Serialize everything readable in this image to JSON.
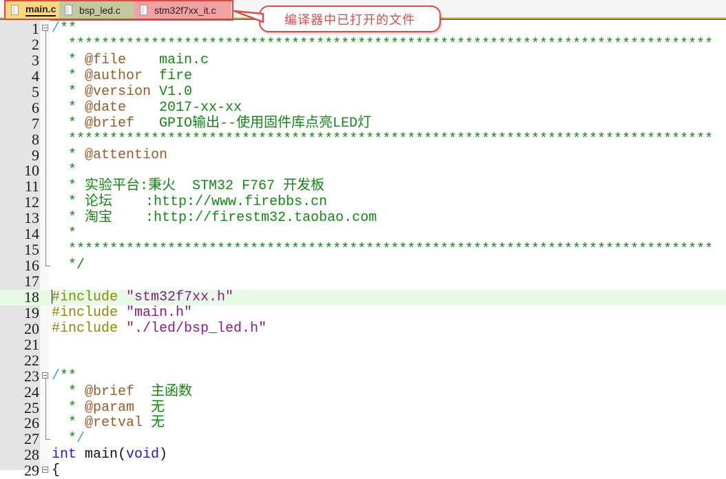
{
  "tabs": [
    {
      "label": "main.c",
      "active": true,
      "color": "#fdd77b"
    },
    {
      "label": "bsp_led.c",
      "active": false,
      "color": "#c2c99c"
    },
    {
      "label": "stm32f7xx_it.c",
      "active": false,
      "color": "#f2a0a0"
    }
  ],
  "annotation": {
    "text": "编译器中已打开的文件",
    "color": "#e24848"
  },
  "editor": {
    "current_line": 18,
    "lines": [
      {
        "n": "1",
        "parts": [
          [
            "slash",
            "/"
          ],
          [
            "cmt",
            "**"
          ]
        ]
      },
      {
        "n": "2",
        "parts": [
          [
            "cmt",
            "  ******************************************************************************"
          ]
        ]
      },
      {
        "n": "3",
        "parts": [
          [
            "cmt",
            "  * "
          ],
          [
            "tag",
            "@file"
          ],
          [
            "cmt",
            "    main.c"
          ]
        ]
      },
      {
        "n": "4",
        "parts": [
          [
            "cmt",
            "  * "
          ],
          [
            "tag",
            "@author"
          ],
          [
            "cmt",
            "  fire"
          ]
        ]
      },
      {
        "n": "5",
        "parts": [
          [
            "cmt",
            "  * "
          ],
          [
            "tag",
            "@version"
          ],
          [
            "cmt",
            " V1.0"
          ]
        ]
      },
      {
        "n": "6",
        "parts": [
          [
            "cmt",
            "  * "
          ],
          [
            "tag",
            "@date"
          ],
          [
            "cmt",
            "    2017-xx-xx"
          ]
        ]
      },
      {
        "n": "7",
        "parts": [
          [
            "cmt",
            "  * "
          ],
          [
            "tag",
            "@brief"
          ],
          [
            "cmt",
            "   GPIO输出--使用固件库点亮LED灯"
          ]
        ]
      },
      {
        "n": "8",
        "parts": [
          [
            "cmt",
            "  ******************************************************************************"
          ]
        ]
      },
      {
        "n": "9",
        "parts": [
          [
            "cmt",
            "  * "
          ],
          [
            "tag",
            "@attention"
          ]
        ]
      },
      {
        "n": "10",
        "parts": [
          [
            "cmt",
            "  *"
          ]
        ]
      },
      {
        "n": "11",
        "parts": [
          [
            "cmt",
            "  * 实验平台:秉火  STM32 F767 开发板"
          ]
        ]
      },
      {
        "n": "12",
        "parts": [
          [
            "cmt",
            "  * 论坛    :http://www.firebbs.cn"
          ]
        ]
      },
      {
        "n": "13",
        "parts": [
          [
            "cmt",
            "  * 淘宝    :http://firestm32.taobao.com"
          ]
        ]
      },
      {
        "n": "14",
        "parts": [
          [
            "cmt",
            "  *"
          ]
        ]
      },
      {
        "n": "15",
        "parts": [
          [
            "cmt",
            "  ******************************************************************************"
          ]
        ]
      },
      {
        "n": "16",
        "parts": [
          [
            "cmt",
            "  */"
          ]
        ]
      },
      {
        "n": "17",
        "parts": []
      },
      {
        "n": "18",
        "parts": [
          [
            "pp",
            "#include "
          ],
          [
            "str",
            "\"stm32f7xx.h\""
          ]
        ]
      },
      {
        "n": "19",
        "parts": [
          [
            "pp",
            "#include "
          ],
          [
            "str",
            "\"main.h\""
          ]
        ]
      },
      {
        "n": "20",
        "parts": [
          [
            "pp",
            "#include "
          ],
          [
            "str",
            "\"./led/bsp_led.h\""
          ]
        ]
      },
      {
        "n": "21",
        "parts": []
      },
      {
        "n": "22",
        "parts": []
      },
      {
        "n": "23",
        "parts": [
          [
            "slash",
            "/"
          ],
          [
            "cmt",
            "**"
          ]
        ]
      },
      {
        "n": "24",
        "parts": [
          [
            "cmt",
            "  * "
          ],
          [
            "tag",
            "@brief"
          ],
          [
            "cmt",
            "  主函数"
          ]
        ]
      },
      {
        "n": "25",
        "parts": [
          [
            "cmt",
            "  * "
          ],
          [
            "tag",
            "@param"
          ],
          [
            "cmt",
            "  无"
          ]
        ]
      },
      {
        "n": "26",
        "parts": [
          [
            "cmt",
            "  * "
          ],
          [
            "tag",
            "@retval"
          ],
          [
            "cmt",
            " 无"
          ]
        ]
      },
      {
        "n": "27",
        "parts": [
          [
            "cmt",
            "  *"
          ],
          [
            "slash",
            "/"
          ]
        ]
      },
      {
        "n": "28",
        "parts": [
          [
            "kw",
            "int"
          ],
          [
            "id",
            " main("
          ],
          [
            "kw",
            "void"
          ],
          [
            "id",
            ")"
          ]
        ]
      },
      {
        "n": "29",
        "parts": [
          [
            "id",
            "{"
          ]
        ]
      }
    ]
  }
}
